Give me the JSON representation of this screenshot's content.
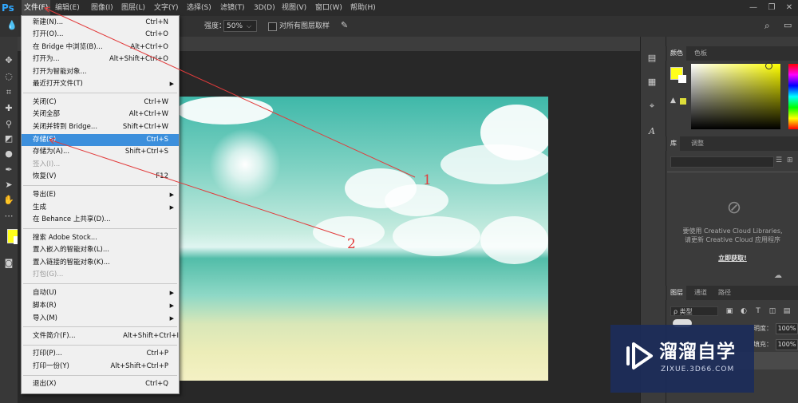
{
  "app": {
    "logo": "Ps"
  },
  "menubar": {
    "items": [
      "文件(F)",
      "编辑(E)",
      "图像(I)",
      "图层(L)",
      "文字(Y)",
      "选择(S)",
      "滤镜(T)",
      "3D(D)",
      "视图(V)",
      "窗口(W)",
      "帮助(H)"
    ]
  },
  "options_bar": {
    "strength_label": "强度：",
    "strength_value": "50%",
    "sample_all_layers_label": "对所有图层取样"
  },
  "file_menu": {
    "items": [
      {
        "label": "新建(N)...",
        "shortcut": "Ctrl+N"
      },
      {
        "label": "打开(O)...",
        "shortcut": "Ctrl+O"
      },
      {
        "label": "在 Bridge 中浏览(B)...",
        "shortcut": "Alt+Ctrl+O"
      },
      {
        "label": "打开为...",
        "shortcut": "Alt+Shift+Ctrl+O"
      },
      {
        "label": "打开为智能对象...",
        "shortcut": ""
      },
      {
        "label": "最近打开文件(T)",
        "shortcut": "",
        "submenu": true
      },
      {
        "label": "关闭(C)",
        "shortcut": "Ctrl+W"
      },
      {
        "label": "关闭全部",
        "shortcut": "Alt+Ctrl+W"
      },
      {
        "label": "关闭并转到 Bridge...",
        "shortcut": "Shift+Ctrl+W"
      },
      {
        "label": "存储(S)",
        "shortcut": "Ctrl+S",
        "highlighted": true
      },
      {
        "label": "存储为(A)...",
        "shortcut": "Shift+Ctrl+S"
      },
      {
        "label": "签入(I)...",
        "shortcut": "",
        "disabled": true
      },
      {
        "label": "恢复(V)",
        "shortcut": "F12"
      },
      {
        "label": "导出(E)",
        "shortcut": "",
        "submenu": true
      },
      {
        "label": "生成",
        "shortcut": "",
        "submenu": true
      },
      {
        "label": "在 Behance 上共享(D)...",
        "shortcut": ""
      },
      {
        "label": "搜索 Adobe Stock...",
        "shortcut": ""
      },
      {
        "label": "置入嵌入的智能对象(L)...",
        "shortcut": ""
      },
      {
        "label": "置入链接的智能对象(K)...",
        "shortcut": ""
      },
      {
        "label": "打包(G)...",
        "shortcut": "",
        "disabled": true
      },
      {
        "label": "自动(U)",
        "shortcut": "",
        "submenu": true
      },
      {
        "label": "脚本(R)",
        "shortcut": "",
        "submenu": true
      },
      {
        "label": "导入(M)",
        "shortcut": "",
        "submenu": true
      },
      {
        "label": "文件简介(F)...",
        "shortcut": "Alt+Shift+Ctrl+I"
      },
      {
        "label": "打印(P)...",
        "shortcut": "Ctrl+P"
      },
      {
        "label": "打印一份(Y)",
        "shortcut": "Alt+Shift+Ctrl+P"
      },
      {
        "label": "退出(X)",
        "shortcut": "Ctrl+Q"
      }
    ]
  },
  "panels": {
    "color_tabs": [
      "颜色",
      "色板"
    ],
    "library_tabs": [
      "库",
      "调整"
    ],
    "library_message_1": "要使用 Creative Cloud Libraries,",
    "library_message_2": "请更新 Creative Cloud 应用程序",
    "library_link": "立即获取!",
    "layers_tabs": [
      "图层",
      "通道",
      "路径"
    ],
    "layer_filter": "ρ 类型",
    "opacity_label": "明度：",
    "opacity_value": "100%",
    "fill_label": "填充：",
    "fill_value": "100%"
  },
  "annotations": {
    "one": "1",
    "two": "2"
  },
  "watermark": {
    "title": "溜溜自学",
    "url": "ZIXUE.3D66.COM"
  },
  "colors": {
    "foreground": "#ffff1a",
    "highlight": "#3c8fdc",
    "annotation": "#e23b3b"
  }
}
